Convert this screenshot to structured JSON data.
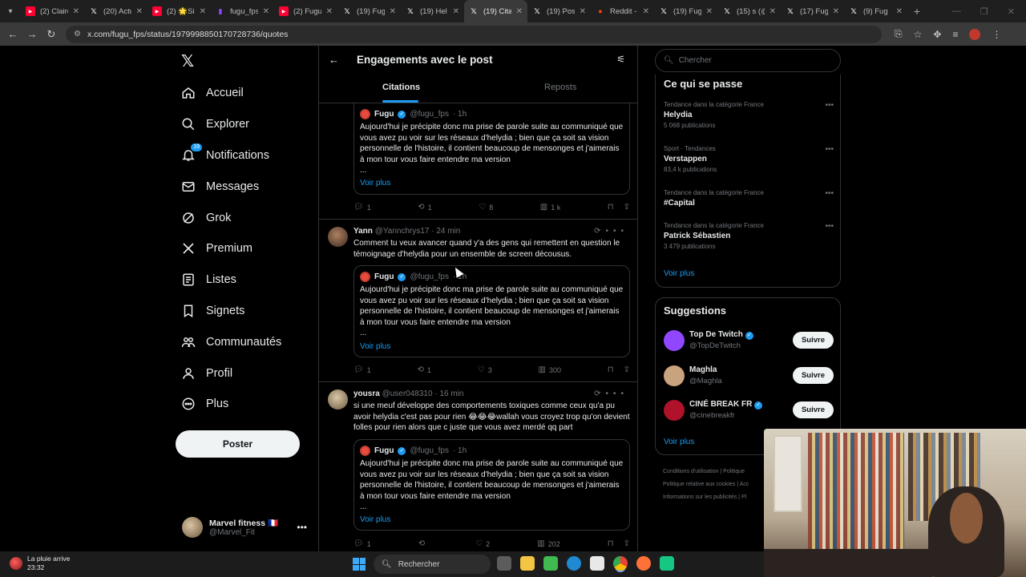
{
  "browser": {
    "tabs": [
      {
        "label": "(2) Claire",
        "icon": "youtube-icon",
        "color": "#ff0033"
      },
      {
        "label": "(20) Actu",
        "icon": "x-icon",
        "color": "#ffffff"
      },
      {
        "label": "(2) 🌟Si",
        "icon": "youtube-icon",
        "color": "#ff0033"
      },
      {
        "label": "fugu_fps",
        "icon": "twitch-icon",
        "color": "#9146ff"
      },
      {
        "label": "(2) Fugu",
        "icon": "youtube-icon",
        "color": "#ff0033"
      },
      {
        "label": "(19) Fug",
        "icon": "x-icon",
        "color": "#ffffff"
      },
      {
        "label": "(19) Hel",
        "icon": "x-icon",
        "color": "#ffffff"
      },
      {
        "label": "(19) Cita",
        "icon": "x-icon",
        "color": "#ffffff",
        "active": true
      },
      {
        "label": "(19) Pos",
        "icon": "x-icon",
        "color": "#ffffff"
      },
      {
        "label": "Reddit -",
        "icon": "reddit-icon",
        "color": "#ff4500"
      },
      {
        "label": "(19) Fug",
        "icon": "x-icon",
        "color": "#ffffff"
      },
      {
        "label": "(15) s (@",
        "icon": "x-icon",
        "color": "#ffffff"
      },
      {
        "label": "(17) Fug",
        "icon": "x-icon",
        "color": "#ffffff"
      },
      {
        "label": "(9) Fug",
        "icon": "x-icon",
        "color": "#ffffff"
      }
    ],
    "url": "x.com/fugu_fps/status/1979998850170728736/quotes"
  },
  "sidebar": {
    "logo": "𝕏",
    "items": [
      {
        "label": "Accueil",
        "icon": "home-icon"
      },
      {
        "label": "Explorer",
        "icon": "search-icon"
      },
      {
        "label": "Notifications",
        "icon": "bell-icon",
        "badge": "19"
      },
      {
        "label": "Messages",
        "icon": "mail-icon"
      },
      {
        "label": "Grok",
        "icon": "grok-icon"
      },
      {
        "label": "Premium",
        "icon": "x-premium-icon"
      },
      {
        "label": "Listes",
        "icon": "list-icon"
      },
      {
        "label": "Signets",
        "icon": "bookmark-icon"
      },
      {
        "label": "Communautés",
        "icon": "communities-icon"
      },
      {
        "label": "Profil",
        "icon": "profile-icon"
      },
      {
        "label": "Plus",
        "icon": "more-circle-icon"
      }
    ],
    "post_button": "Poster",
    "account": {
      "name": "Marvel fitness 🇫🇷",
      "handle": "@Marvel_Fit"
    }
  },
  "center": {
    "title": "Engagements avec le post",
    "tabs": [
      "Citations",
      "Reposts"
    ],
    "quoted": {
      "name": "Fugu",
      "handle": "@fugu_fps",
      "time": "· 1h",
      "text": "Aujourd'hui je précipite donc ma prise de parole suite au communiqué que vous avez pu voir sur les réseaux d'helydia ; bien que ça soit sa vision personnelle de l'histoire, il contient beaucoup de mensonges et j'aimerais à mon tour vous faire entendre ma version",
      "ellipsis": "...",
      "more": "Voir plus"
    },
    "posts": [
      {
        "name": "",
        "handle": "",
        "time": "",
        "text": "",
        "actions": {
          "replies": "1",
          "reposts": "1",
          "likes": "8",
          "views": "1 k"
        }
      },
      {
        "name": "Yann",
        "handle": "@Yannchrys17",
        "time": "· 24 min",
        "text": "Comment tu veux avancer quand y'a des gens qui remettent en question le témoignage d'helydia pour un ensemble de screen décousus.",
        "actions": {
          "replies": "1",
          "reposts": "1",
          "likes": "3",
          "views": "300"
        }
      },
      {
        "name": "yousra",
        "handle": "@user048310",
        "time": "· 16 min",
        "text": "si une meuf développe des comportements toxiques comme ceux qu'a pu avoir helydia c'est pas pour rien 😂😂😂wallah vous croyez trop qu'on devient folles pour rien alors que c juste que vous avez merdé qq part",
        "actions": {
          "replies": "1",
          "reposts": "",
          "likes": "2",
          "views": "202"
        }
      }
    ]
  },
  "right": {
    "search_placeholder": "Chercher",
    "trends_title": "Ce qui se passe",
    "trends": [
      {
        "category": "Tendance dans la catégorie France",
        "name": "Helydia",
        "count": "5 068 publications"
      },
      {
        "category": "Sport · Tendances",
        "name": "Verstappen",
        "count": "83,4 k publications"
      },
      {
        "category": "Tendance dans la catégorie France",
        "name": "#Capital",
        "count": ""
      },
      {
        "category": "Tendance dans la catégorie France",
        "name": "Patrick Sébastien",
        "count": "3 479 publications"
      }
    ],
    "voir_plus": "Voir plus",
    "suggestions_title": "Suggestions",
    "suggestions": [
      {
        "name": "Top De Twitch",
        "handle": "@TopDeTwitch",
        "button": "Suivre",
        "color": "#9146ff"
      },
      {
        "name": "Maghla",
        "handle": "@Maghla",
        "button": "Suivre",
        "color": "#c9a27e"
      },
      {
        "name": "CINÉ BREAK FR",
        "handle": "@cinebreakfr",
        "button": "Suivre",
        "color": "#b0122b"
      }
    ],
    "footer": [
      "Conditions d'utilisation",
      "Politique",
      "Politique relative aux cookies",
      "Acc",
      "Informations sur les publicités",
      "Pl"
    ]
  },
  "taskbar": {
    "weather": "La pluie arrive",
    "time": "23:32",
    "search": "Rechercher"
  },
  "colors": {
    "accent": "#1d9bf0",
    "background": "#000000",
    "border": "#2f3336"
  }
}
